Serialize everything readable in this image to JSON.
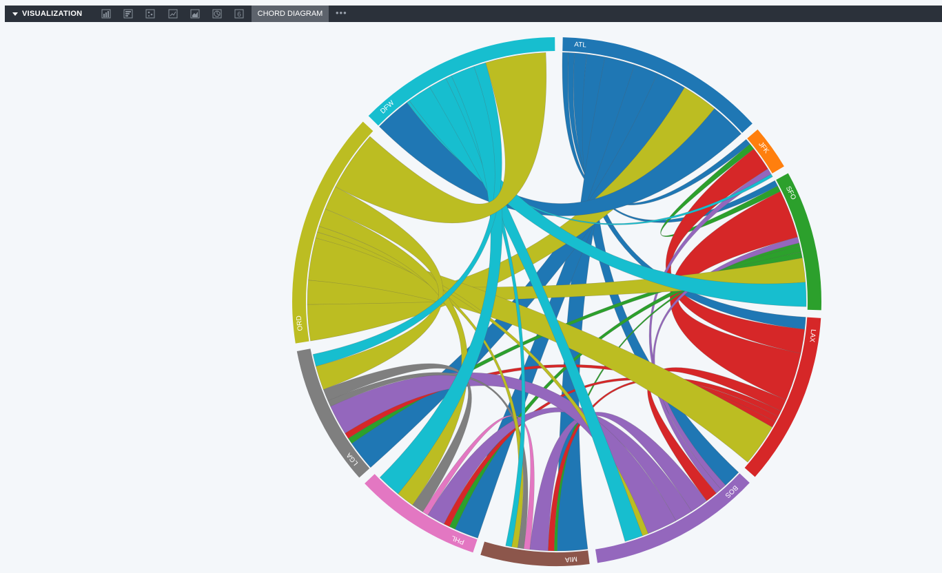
{
  "toolbar": {
    "title": "VISUALIZATION",
    "active_tab": "CHORD DIAGRAM",
    "more": "•••",
    "icons": [
      "bar-chart-icon",
      "horizontal-bar-icon",
      "scatter-icon",
      "line-chart-icon",
      "area-chart-icon",
      "pie-chart-icon",
      "number-six-icon"
    ],
    "number_icon_text": "6"
  },
  "chart_data": {
    "type": "chord",
    "groups": [
      {
        "name": "ATL",
        "value": 33,
        "color": "#1f77b4"
      },
      {
        "name": "JFK",
        "value": 7,
        "color": "#ff7f0e"
      },
      {
        "name": "SFO",
        "value": 22,
        "color": "#2ca02c"
      },
      {
        "name": "LAX",
        "value": 27,
        "color": "#d62728"
      },
      {
        "name": "BOS",
        "value": 27,
        "color": "#9467bd"
      },
      {
        "name": "MIA",
        "value": 17,
        "color": "#8c564b"
      },
      {
        "name": "PHL",
        "value": 20,
        "color": "#e377c2"
      },
      {
        "name": "LGA",
        "value": 22,
        "color": "#7f7f7f"
      },
      {
        "name": "ORD",
        "value": 37,
        "color": "#bcbd22"
      },
      {
        "name": "DFW",
        "value": 32,
        "color": "#17becf"
      }
    ],
    "flows": [
      [
        "ATL",
        "JFK",
        1
      ],
      [
        "ATL",
        "SFO",
        1
      ],
      [
        "ATL",
        "LAX",
        2
      ],
      [
        "ATL",
        "BOS",
        3
      ],
      [
        "ATL",
        "MIA",
        5
      ],
      [
        "ATL",
        "PHL",
        4
      ],
      [
        "ATL",
        "LGA",
        5
      ],
      [
        "ATL",
        "ORD",
        6
      ],
      [
        "ATL",
        "DFW",
        6
      ],
      [
        "JFK",
        "SFO",
        1
      ],
      [
        "JFK",
        "LAX",
        4
      ],
      [
        "JFK",
        "BOS",
        1
      ],
      [
        "JFK",
        "DFW",
        0.5
      ],
      [
        "SFO",
        "LAX",
        8
      ],
      [
        "SFO",
        "BOS",
        1
      ],
      [
        "SFO",
        "MIA",
        0.5
      ],
      [
        "SFO",
        "PHL",
        1
      ],
      [
        "SFO",
        "LGA",
        1
      ],
      [
        "SFO",
        "ORD",
        4
      ],
      [
        "SFO",
        "DFW",
        4
      ],
      [
        "LAX",
        "BOS",
        2
      ],
      [
        "LAX",
        "MIA",
        1
      ],
      [
        "LAX",
        "PHL",
        1
      ],
      [
        "LAX",
        "LGA",
        1
      ],
      [
        "LAX",
        "ORD",
        7
      ],
      [
        "BOS",
        "MIA",
        3
      ],
      [
        "BOS",
        "PHL",
        3
      ],
      [
        "BOS",
        "LGA",
        5
      ],
      [
        "BOS",
        "ORD",
        1
      ],
      [
        "BOS",
        "DFW",
        3
      ],
      [
        "MIA",
        "PHL",
        1
      ],
      [
        "MIA",
        "LGA",
        1
      ],
      [
        "MIA",
        "ORD",
        1
      ],
      [
        "MIA",
        "DFW",
        1
      ],
      [
        "PHL",
        "LGA",
        2
      ],
      [
        "PHL",
        "ORD",
        3
      ],
      [
        "PHL",
        "DFW",
        4
      ],
      [
        "LGA",
        "ORD",
        4
      ],
      [
        "LGA",
        "DFW",
        2
      ],
      [
        "ORD",
        "DFW",
        10
      ]
    ]
  }
}
